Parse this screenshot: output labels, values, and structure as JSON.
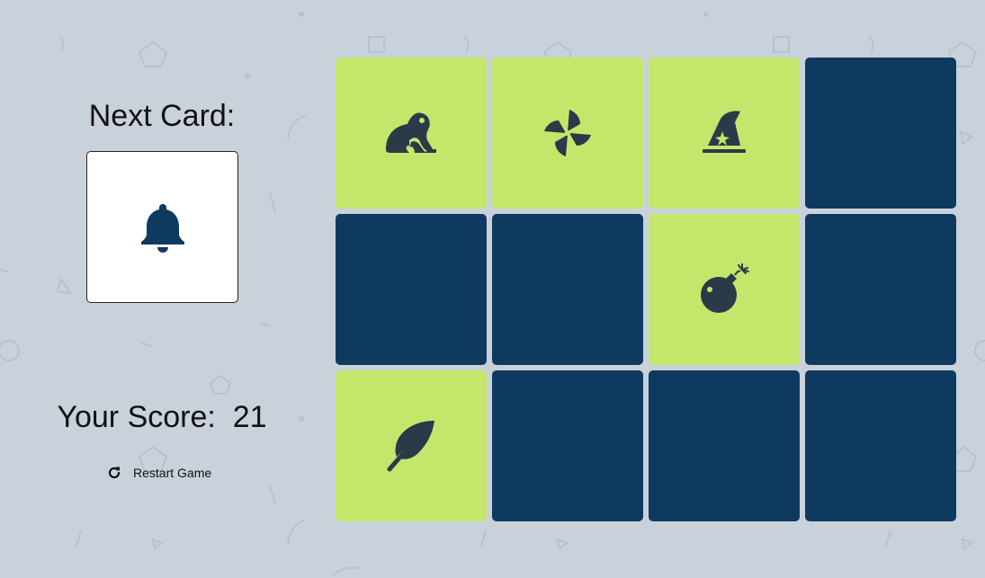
{
  "colors": {
    "background": "#c9d2db",
    "card_face_up": "#c4e76b",
    "card_face_down": "#0f3a5f",
    "icon": "#2b3a48",
    "next_card_icon": "#0f3a5f"
  },
  "next_card": {
    "title": "Next Card:",
    "icon": "bell-icon"
  },
  "score": {
    "label": "Your Score:",
    "value": "21"
  },
  "restart": {
    "label": "Restart Game",
    "icon": "restart-icon"
  },
  "grid": {
    "cards": [
      {
        "state": "face-up",
        "icon": "frog-icon"
      },
      {
        "state": "face-up",
        "icon": "pinwheel-icon"
      },
      {
        "state": "face-up",
        "icon": "wizard-hat-icon"
      },
      {
        "state": "face-down",
        "icon": ""
      },
      {
        "state": "face-down",
        "icon": ""
      },
      {
        "state": "face-down",
        "icon": ""
      },
      {
        "state": "face-up",
        "icon": "bomb-icon"
      },
      {
        "state": "face-down",
        "icon": ""
      },
      {
        "state": "face-up",
        "icon": "feather-icon"
      },
      {
        "state": "face-down",
        "icon": ""
      },
      {
        "state": "face-down",
        "icon": ""
      },
      {
        "state": "face-down",
        "icon": ""
      }
    ]
  }
}
